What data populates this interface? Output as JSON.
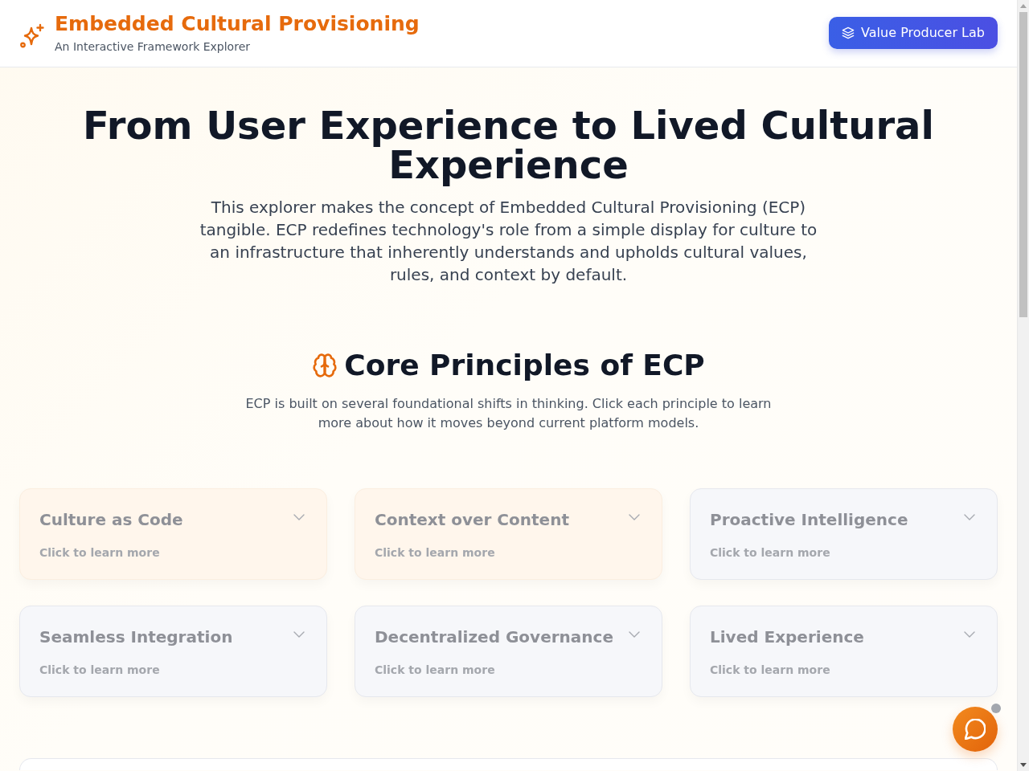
{
  "header": {
    "title": "Embedded Cultural Provisioning",
    "subtitle": "An Interactive Framework Explorer",
    "button": "Value Producer Lab"
  },
  "hero": {
    "title": "From User Experience to Lived Cultural Experience",
    "text": "This explorer makes the concept of Embedded Cultural Provisioning (ECP) tangible. ECP redefines technology's role from a simple display for culture to an infrastructure that inherently understands and upholds cultural values, rules, and context by default."
  },
  "principles": {
    "heading": "Core Principles of ECP",
    "intro": "ECP is built on several foundational shifts in thinking. Click each principle to learn more about how it moves beyond current platform models.",
    "cards": [
      {
        "title": "Culture as Code",
        "hint": "Click to learn more",
        "kind": "warm",
        "expanded": false
      },
      {
        "title": "Context over Content",
        "hint": "Click to learn more",
        "kind": "warm",
        "expanded": false
      },
      {
        "title": "Proactive Intelligence",
        "hint": "Click to learn more",
        "kind": "cool",
        "expanded": false
      },
      {
        "title": "Seamless Integration",
        "hint": "Click to learn more",
        "kind": "cool",
        "expanded": false
      },
      {
        "title": "Decentralized Governance",
        "hint": "Click to learn more",
        "kind": "cool",
        "expanded": false
      },
      {
        "title": "Lived Experience",
        "hint": "Click to learn more",
        "kind": "cool",
        "expanded": false
      }
    ]
  }
}
